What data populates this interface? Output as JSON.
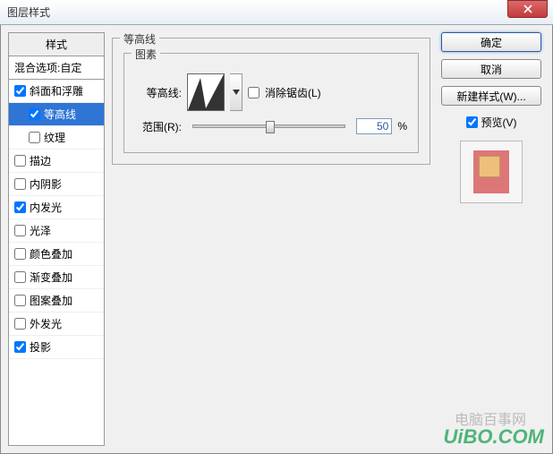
{
  "window": {
    "title": "图层样式"
  },
  "sidebar": {
    "header": "样式",
    "blend": "混合选项:自定",
    "items": [
      {
        "label": "斜面和浮雕",
        "checked": true,
        "sub": false
      },
      {
        "label": "等高线",
        "checked": true,
        "sub": true,
        "selected": true
      },
      {
        "label": "纹理",
        "checked": false,
        "sub": true
      },
      {
        "label": "描边",
        "checked": false,
        "sub": false
      },
      {
        "label": "内阴影",
        "checked": false,
        "sub": false
      },
      {
        "label": "内发光",
        "checked": true,
        "sub": false
      },
      {
        "label": "光泽",
        "checked": false,
        "sub": false
      },
      {
        "label": "颜色叠加",
        "checked": false,
        "sub": false
      },
      {
        "label": "渐变叠加",
        "checked": false,
        "sub": false
      },
      {
        "label": "图案叠加",
        "checked": false,
        "sub": false
      },
      {
        "label": "外发光",
        "checked": false,
        "sub": false
      },
      {
        "label": "投影",
        "checked": true,
        "sub": false
      }
    ]
  },
  "panel": {
    "outer_title": "等高线",
    "inner_title": "图素",
    "contour_label": "等高线:",
    "antialias_label": "消除锯齿(L)",
    "antialias_checked": false,
    "range_label": "范围(R):",
    "range_value": "50",
    "range_unit": "%"
  },
  "buttons": {
    "ok": "确定",
    "cancel": "取消",
    "new_style": "新建样式(W)...",
    "preview_label": "预览(V)",
    "preview_checked": true
  },
  "watermark": {
    "line1": "电脑百事网",
    "line2": "UiBO.COM"
  }
}
